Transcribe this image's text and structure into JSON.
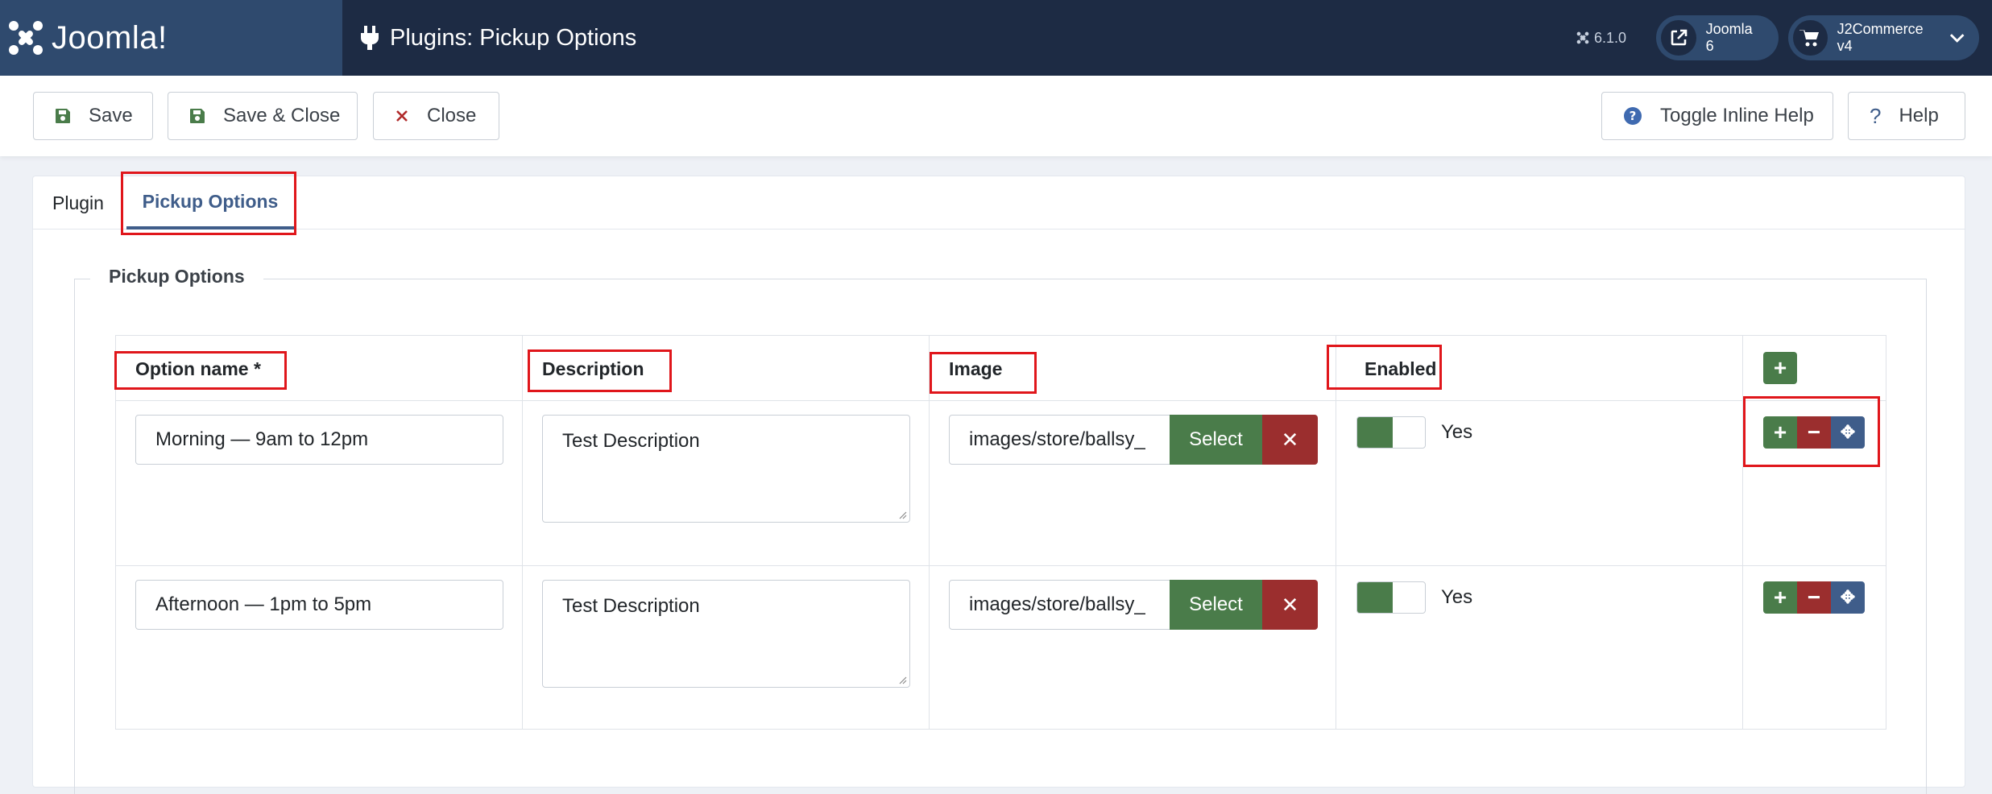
{
  "header": {
    "logo_text": "Joomla!",
    "title": "Plugins: Pickup Options",
    "version": "6.1.0",
    "site_link_label": "Joomla 6",
    "component_menu_label": "J2Commerce v4"
  },
  "toolbar": {
    "save_label": "Save",
    "save_close_label": "Save & Close",
    "close_label": "Close",
    "inline_help_label": "Toggle Inline Help",
    "help_label": "Help"
  },
  "tabs": [
    {
      "label": "Plugin",
      "active": false
    },
    {
      "label": "Pickup Options",
      "active": true
    }
  ],
  "fieldset": {
    "legend": "Pickup Options",
    "columns": {
      "option_name": "Option name *",
      "description": "Description",
      "image": "Image",
      "enabled": "Enabled"
    },
    "rows": [
      {
        "option_name": "Morning — 9am to 12pm",
        "description": "Test Description",
        "image": "images/store/ballsy_",
        "select_label": "Select",
        "enabled_label": "Yes"
      },
      {
        "option_name": "Afternoon — 1pm to 5pm",
        "description": "Test Description",
        "image": "images/store/ballsy_",
        "select_label": "Select",
        "enabled_label": "Yes"
      }
    ]
  },
  "colors": {
    "header_bg": "#1d2b44",
    "logo_bg": "#2f4a6e",
    "success": "#4a7c4a",
    "danger": "#9b2e2e",
    "primary": "#3f5d8a",
    "highlight": "#e0161b"
  }
}
